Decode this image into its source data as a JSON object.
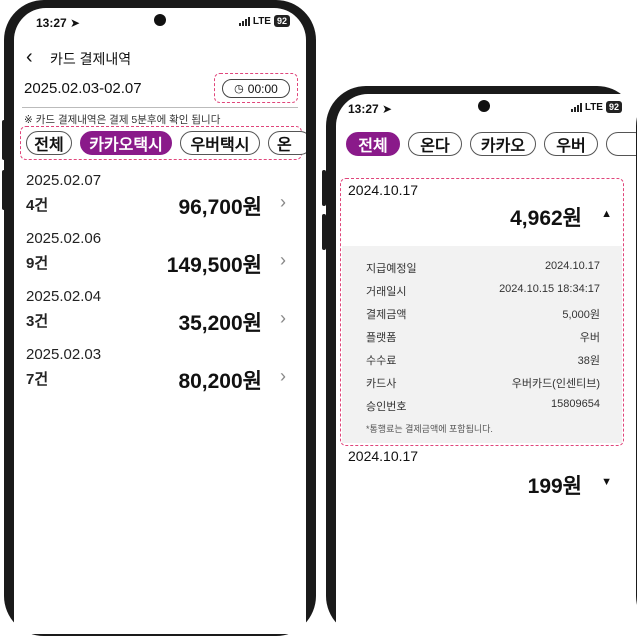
{
  "left": {
    "status": {
      "time": "13:27",
      "network": "LTE",
      "battery": "92"
    },
    "header": {
      "title": "카드 결제내역"
    },
    "period": {
      "range": "2025.02.03-02.07",
      "time_button": "00:00"
    },
    "notice": "※ 카드 결제내역은 결제 5분후에 확인 됩니다",
    "filters": [
      {
        "label": "전체",
        "active": false
      },
      {
        "label": "카카오택시",
        "active": true
      },
      {
        "label": "우버택시",
        "active": false
      },
      {
        "label": "온",
        "active": false
      }
    ],
    "rows": [
      {
        "date": "2025.02.07",
        "count": "4건",
        "amount": "96,700원"
      },
      {
        "date": "2025.02.06",
        "count": "9건",
        "amount": "149,500원"
      },
      {
        "date": "2025.02.04",
        "count": "3건",
        "amount": "35,200원"
      },
      {
        "date": "2025.02.03",
        "count": "7건",
        "amount": "80,200원"
      }
    ]
  },
  "right": {
    "status": {
      "time": "13:27",
      "network": "LTE",
      "battery": "92"
    },
    "filters": [
      {
        "label": "전체",
        "active": true
      },
      {
        "label": "온다",
        "active": false
      },
      {
        "label": "카카오",
        "active": false
      },
      {
        "label": "우버",
        "active": false
      },
      {
        "label": "",
        "active": false
      }
    ],
    "entries": [
      {
        "date": "2024.10.17",
        "amount": "4,962원",
        "expanded": true
      },
      {
        "date": "2024.10.17",
        "amount": "199원",
        "expanded": false
      }
    ],
    "details": [
      {
        "key": "지급예정일",
        "value": "2024.10.17"
      },
      {
        "key": "거래일시",
        "value": "2024.10.15 18:34:17"
      },
      {
        "key": "결제금액",
        "value": "5,000원"
      },
      {
        "key": "플랫폼",
        "value": "우버"
      },
      {
        "key": "수수료",
        "value": "38원"
      },
      {
        "key": "카드사",
        "value": "우버카드(인센티브)"
      },
      {
        "key": "승인번호",
        "value": "15809654"
      }
    ],
    "detail_note": "*통행료는 결제금액에 포함됩니다."
  },
  "colors": {
    "accent": "#8a1a8a",
    "highlight": "#e0457b",
    "bezel": "#1a1a1a"
  }
}
